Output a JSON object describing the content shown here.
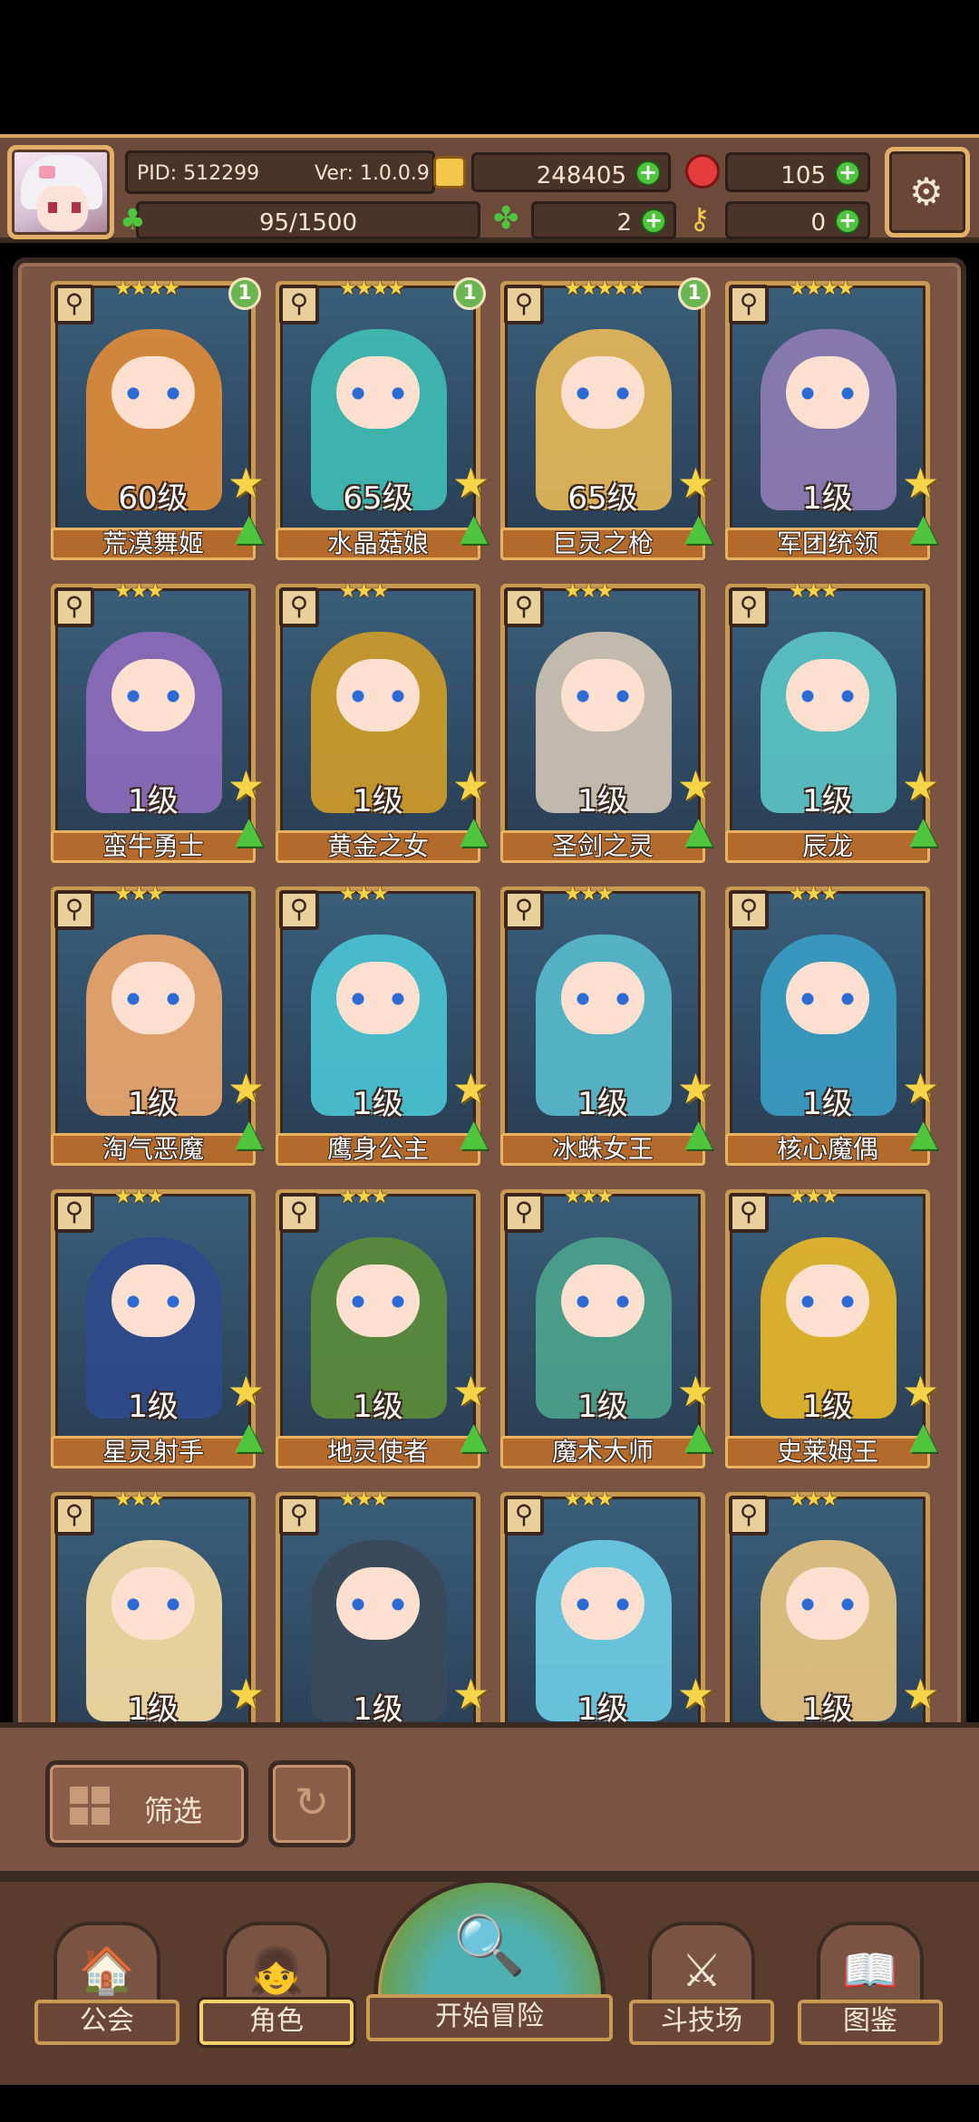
{
  "player": {
    "pid": "PID: 512299",
    "version": "Ver: 1.0.0.9",
    "coins": "248405",
    "gems": "105",
    "energy": "95/1500",
    "clovers": "2",
    "keys": "0"
  },
  "icons": {
    "coin": "coin-icon",
    "gem": "gem-icon",
    "clover": "clover-icon",
    "key": "key-icon",
    "settings": "gear-icon"
  },
  "characters": [
    {
      "name": "荒漠舞姬",
      "level": "60级",
      "stars": "★★★★",
      "badge": "1",
      "color": "#d98a3a"
    },
    {
      "name": "水晶菇娘",
      "level": "65级",
      "stars": "★★★★",
      "badge": "1",
      "color": "#3fb8b0"
    },
    {
      "name": "巨灵之枪",
      "level": "65级",
      "stars": "★★★★★",
      "badge": "1",
      "color": "#e0b458"
    },
    {
      "name": "军团统领",
      "level": "1级",
      "stars": "★★★★",
      "badge": "",
      "color": "#8a7ab0"
    },
    {
      "name": "蛮牛勇士",
      "level": "1级",
      "stars": "★★★",
      "badge": "",
      "color": "#8a6ab8"
    },
    {
      "name": "黄金之女",
      "level": "1级",
      "stars": "★★★",
      "badge": "",
      "color": "#c99a2a"
    },
    {
      "name": "圣剑之灵",
      "level": "1级",
      "stars": "★★★",
      "badge": "",
      "color": "#c9c0b0"
    },
    {
      "name": "辰龙",
      "level": "1级",
      "stars": "★★★",
      "badge": "",
      "color": "#5ac0c0"
    },
    {
      "name": "淘气恶魔",
      "level": "1级",
      "stars": "★★★",
      "badge": "",
      "color": "#e6a36a"
    },
    {
      "name": "鹰身公主",
      "level": "1级",
      "stars": "★★★",
      "badge": "",
      "color": "#4ac0d0"
    },
    {
      "name": "冰蛛女王",
      "level": "1级",
      "stars": "★★★",
      "badge": "",
      "color": "#56b6c8"
    },
    {
      "name": "核心魔偶",
      "level": "1级",
      "stars": "★★★",
      "badge": "",
      "color": "#3a9ac0"
    },
    {
      "name": "星灵射手",
      "level": "1级",
      "stars": "★★★",
      "badge": "",
      "color": "#2e4a8a"
    },
    {
      "name": "地灵使者",
      "level": "1级",
      "stars": "★★★",
      "badge": "",
      "color": "#5a8a3a"
    },
    {
      "name": "魔术大师",
      "level": "1级",
      "stars": "★★★",
      "badge": "",
      "color": "#4aa08a"
    },
    {
      "name": "史莱姆王",
      "level": "1级",
      "stars": "★★★",
      "badge": "",
      "color": "#e0b42a"
    },
    {
      "name": "",
      "level": "1级",
      "stars": "★★★",
      "badge": "",
      "color": "#f0d8a0"
    },
    {
      "name": "",
      "level": "1级",
      "stars": "★★★",
      "badge": "",
      "color": "#3a4a5a"
    },
    {
      "name": "",
      "level": "1级",
      "stars": "★★★",
      "badge": "",
      "color": "#6ac8e0"
    },
    {
      "name": "",
      "level": "1级",
      "stars": "★★★",
      "badge": "",
      "color": "#e0c080"
    }
  ],
  "filter": {
    "label": "筛选"
  },
  "nav": {
    "guild": "公会",
    "characters": "角色",
    "adventure": "开始冒险",
    "arena": "斗技场",
    "codex": "图鉴"
  }
}
